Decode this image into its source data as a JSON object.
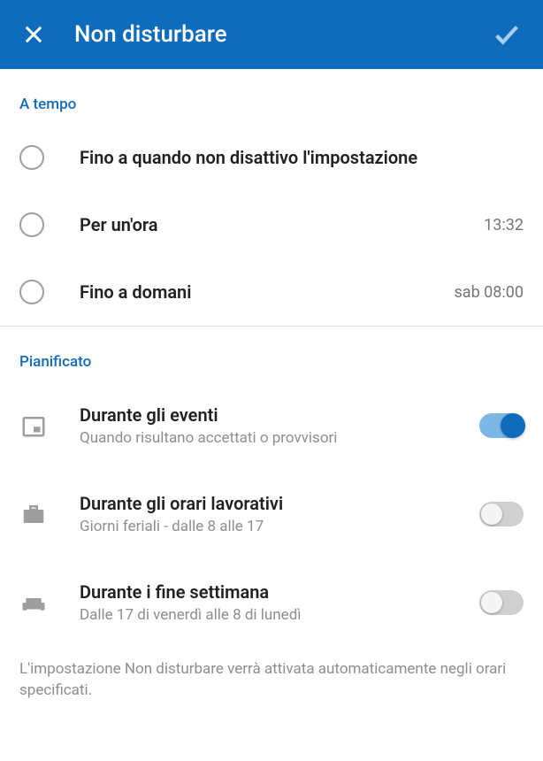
{
  "header": {
    "title": "Non disturbare"
  },
  "sections": {
    "timed": {
      "label": "A tempo",
      "options": [
        {
          "label": "Fino a quando non disattivo l'impostazione",
          "time": ""
        },
        {
          "label": "Per un'ora",
          "time": "13:32"
        },
        {
          "label": "Fino a domani",
          "time": "sab 08:00"
        }
      ]
    },
    "scheduled": {
      "label": "Pianificato",
      "options": [
        {
          "title": "Durante gli eventi",
          "subtitle": "Quando risultano accettati o provvisori",
          "enabled": true
        },
        {
          "title": "Durante gli orari lavorativi",
          "subtitle": "Giorni feriali - dalle 8 alle 17",
          "enabled": false
        },
        {
          "title": "Durante i fine settimana",
          "subtitle": "Dalle 17 di venerdì alle 8 di lunedì",
          "enabled": false
        }
      ]
    }
  },
  "footer": "L'impostazione Non disturbare verrà attivata automaticamente negli orari specificati."
}
